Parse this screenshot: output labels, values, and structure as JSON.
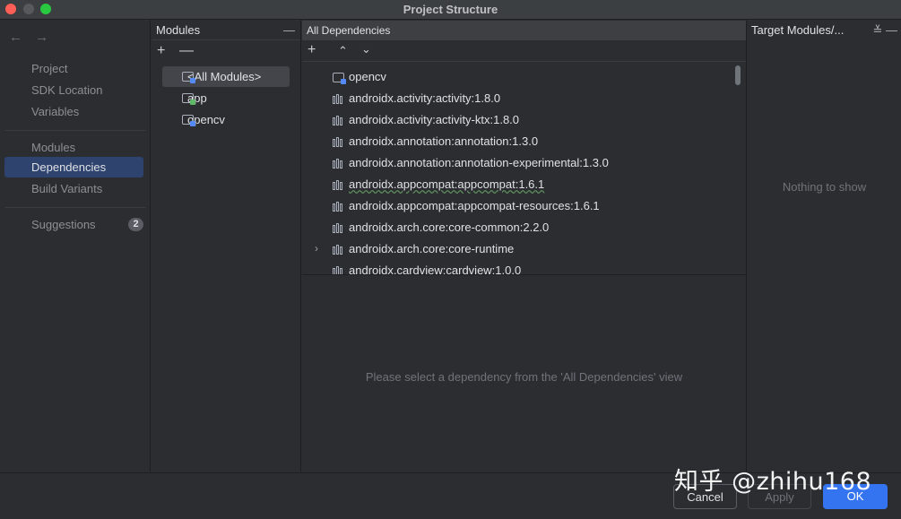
{
  "window": {
    "title": "Project Structure"
  },
  "nav": {
    "back": "←",
    "forward": "→",
    "items": [
      {
        "label": "Project"
      },
      {
        "label": "SDK Location"
      },
      {
        "label": "Variables"
      },
      {
        "label": "Modules"
      },
      {
        "label": "Dependencies",
        "selected": true
      },
      {
        "label": "Build Variants"
      },
      {
        "label": "Suggestions",
        "badge": "2"
      }
    ]
  },
  "modules": {
    "header": "Modules",
    "collapse": "—",
    "add": "+",
    "remove": "—",
    "items": [
      {
        "label": "<All Modules>",
        "selected": true
      },
      {
        "label": "app"
      },
      {
        "label": "opencv"
      }
    ]
  },
  "dependencies": {
    "header": "All Dependencies",
    "add": "+",
    "expand": "⌃",
    "collapse": "⌄",
    "items": [
      {
        "label": "opencv",
        "kind": "module"
      },
      {
        "label": "androidx.activity:activity:1.8.0"
      },
      {
        "label": "androidx.activity:activity-ktx:1.8.0"
      },
      {
        "label": "androidx.annotation:annotation:1.3.0"
      },
      {
        "label": "androidx.annotation:annotation-experimental:1.3.0"
      },
      {
        "label": "androidx.appcompat:appcompat:1.6.1"
      },
      {
        "label": "androidx.appcompat:appcompat-resources:1.6.1"
      },
      {
        "label": "androidx.arch.core:core-common:2.2.0"
      },
      {
        "label": "androidx.arch.core:core-runtime",
        "expandable": true
      },
      {
        "label": "androidx.cardview:cardview:1.0.0"
      }
    ],
    "chevron": "›"
  },
  "details": {
    "placeholder": "Please select a dependency from the 'All Dependencies' view"
  },
  "target": {
    "header": "Target Modules/...",
    "buttons": "≚  —",
    "empty": "Nothing to show"
  },
  "footer": {
    "cancel": "Cancel",
    "apply": "Apply",
    "ok": "OK"
  },
  "watermark": "知乎 @zhihu168",
  "colors": {
    "accent": "#3574f0",
    "selection": "#2e436e"
  }
}
